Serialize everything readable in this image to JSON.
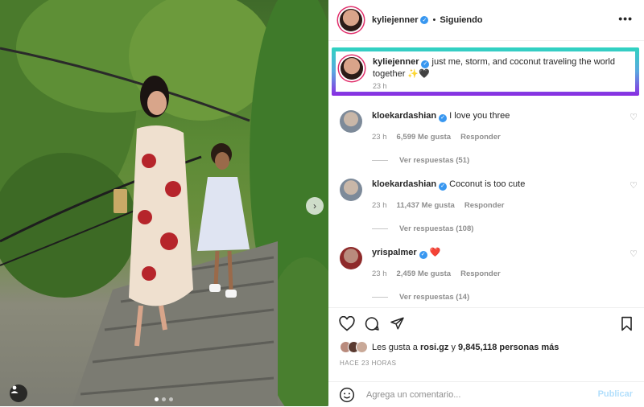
{
  "photo": {
    "tag_icon": "person-tag-icon",
    "next_icon": "chevron-right-icon",
    "carousel": {
      "count": 3,
      "active_index": 0
    }
  },
  "header": {
    "username": "kyliejenner",
    "separator": "•",
    "follow_status": "Siguiendo",
    "more_icon": "more-options-icon",
    "more_text": "•••"
  },
  "caption": {
    "username": "kyliejenner",
    "text": "just me, storm, and coconut traveling the world together ✨🖤",
    "time": "23 h",
    "highlight_colors": [
      "#2fd3c0",
      "#5aa7e0",
      "#8a2be2"
    ]
  },
  "comments": [
    {
      "username": "kloekardashian",
      "text": "I love you three",
      "time": "23 h",
      "likes": "6,599 Me gusta",
      "reply": "Responder",
      "replies": "Ver respuestas (51)"
    },
    {
      "username": "kloekardashian",
      "text": "Coconut is too cute",
      "time": "23 h",
      "likes": "11,437 Me gusta",
      "reply": "Responder",
      "replies": "Ver respuestas (108)"
    },
    {
      "username": "yrispalmer",
      "text": "❤️",
      "time": "23 h",
      "likes": "2,459 Me gusta",
      "reply": "Responder",
      "replies": "Ver respuestas (14)"
    }
  ],
  "actions": {
    "like_icon": "heart-icon",
    "comment_icon": "comment-icon",
    "share_icon": "paper-plane-icon",
    "save_icon": "bookmark-icon"
  },
  "likes": {
    "prefix": "Les gusta a",
    "user": "rosi.gz",
    "middle": "y",
    "count": "9,845,118 personas más"
  },
  "time_ago": "HACE 23 HORAS",
  "add_comment": {
    "placeholder": "Agrega un comentario...",
    "publish_label": "Publicar",
    "emoji_icon": "emoji-icon"
  },
  "colors": {
    "verified": "#3897f0",
    "publish": "#b2dffc",
    "secondary_text": "#8e8e8e"
  }
}
